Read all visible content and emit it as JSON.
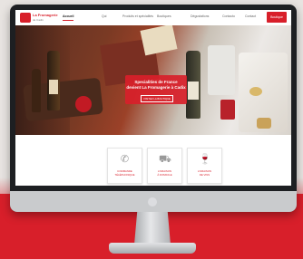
{
  "site": {
    "logo_title": "La Fromagerie",
    "logo_subtitle": "de Cadix",
    "nav": [
      {
        "label": "Accueil",
        "active": true
      },
      {
        "label": "Qui",
        "active": false
      },
      {
        "label": "Produits et spécialités",
        "active": false
      },
      {
        "label": "Boutiques",
        "active": false
      },
      {
        "label": "Dégustations",
        "active": false
      },
      {
        "label": "Contacto",
        "active": false
      },
      {
        "label": "Contact",
        "active": false
      }
    ],
    "cta_label": "Boutique"
  },
  "hero": {
    "title_line1": "Specialities de France",
    "title_line2": "devient La Fromagerie à Cadix",
    "button_label": "VISITEZ LA BOUTIQUE"
  },
  "cards": [
    {
      "label_line1": "COMMANDE",
      "label_line2": "TÉLÉPHONIQUE",
      "icon": "phone-icon",
      "glyph": "✆"
    },
    {
      "label_line1": "LIVRAISON",
      "label_line2": "À DOMICILE",
      "icon": "truck-icon",
      "glyph": "⛟"
    },
    {
      "label_line1": "LIVRAISON",
      "label_line2": "DE VINS",
      "icon": "wine-icon",
      "glyph": "🍷"
    }
  ],
  "colors": {
    "brand": "#d81f2a",
    "frame": "#1d1f22"
  }
}
